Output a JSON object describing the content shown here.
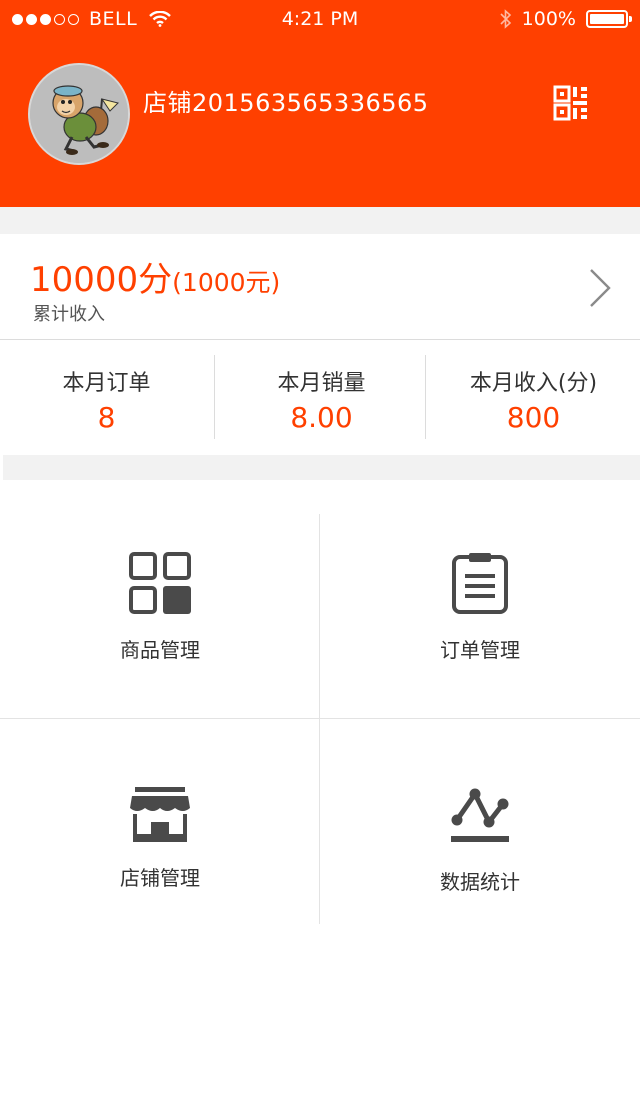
{
  "status_bar": {
    "carrier": "BELL",
    "time": "4:21 PM",
    "battery": "100%"
  },
  "header": {
    "shop_name": "店铺201563565336565"
  },
  "income": {
    "points": "10000分",
    "yuan": "(1000元)",
    "label": "累计收入"
  },
  "stats": [
    {
      "label": "本月订单",
      "value": "8"
    },
    {
      "label": "本月销量",
      "value": "8.00"
    },
    {
      "label": "本月收入(分)",
      "value": "800"
    }
  ],
  "menu": [
    {
      "label": "商品管理",
      "icon": "grid-icon"
    },
    {
      "label": "订单管理",
      "icon": "clipboard-icon"
    },
    {
      "label": "店铺管理",
      "icon": "store-icon"
    },
    {
      "label": "数据统计",
      "icon": "line-chart-icon"
    }
  ],
  "colors": {
    "brand": "#ff4000",
    "icon": "#4a4a4a",
    "gap": "#f2f2f2"
  }
}
